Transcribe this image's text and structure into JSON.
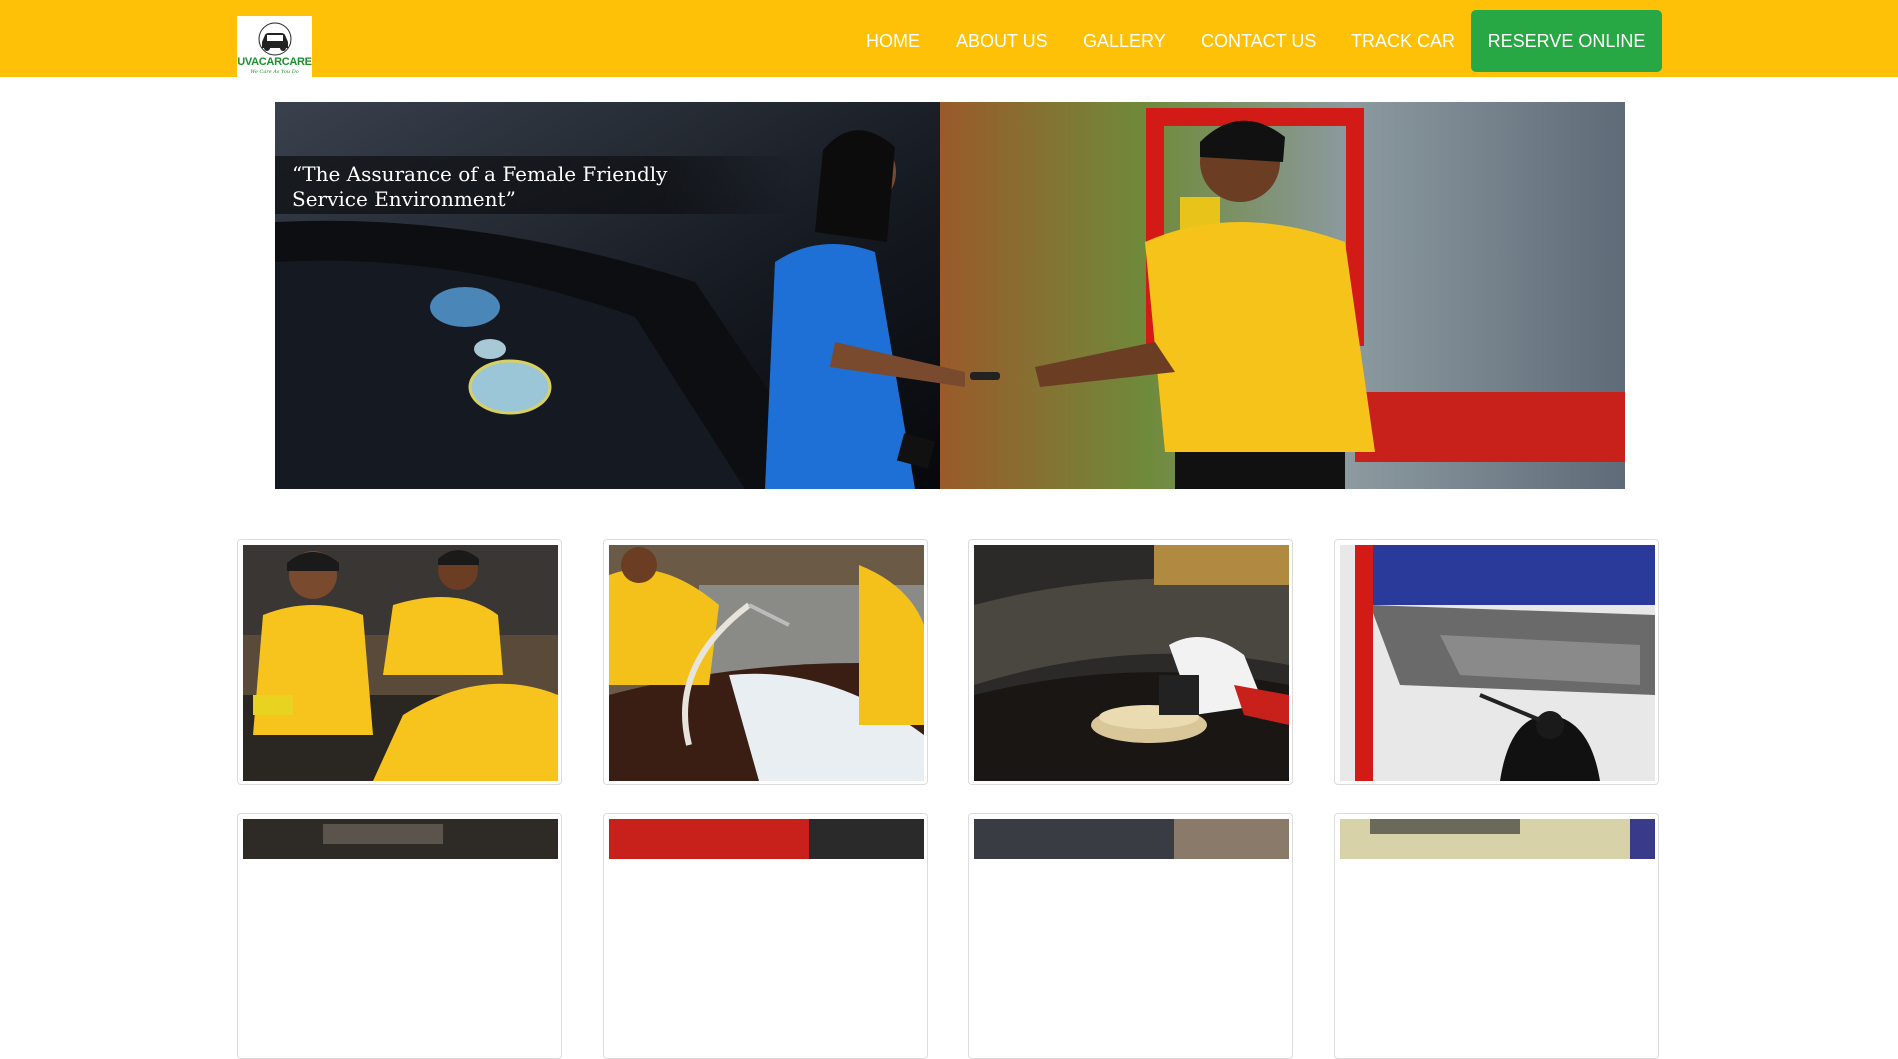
{
  "brand": {
    "logo_icon": "car-icon",
    "name": "UVACARCARE",
    "tagline": "We Care As You Do"
  },
  "nav": {
    "items": [
      "HOME",
      "ABOUT US",
      "GALLERY",
      "CONTACT US",
      "TRACK CAR"
    ],
    "cta": "RESERVE ONLINE"
  },
  "hero": {
    "caption": "“The Assurance of a Female Friendly\n Service Environment”"
  },
  "gallery": {
    "photos": [
      "staff-polishing-photo",
      "car-washing-photo",
      "machine-polishing-photo",
      "undercarriage-inspection-photo",
      "engine-photo",
      "red-car-photo",
      "workshop-photo",
      "interior-photo"
    ]
  },
  "colors": {
    "navbar": "#fec107",
    "cta": "#28a745",
    "logo_green": "#1c8f2e"
  }
}
